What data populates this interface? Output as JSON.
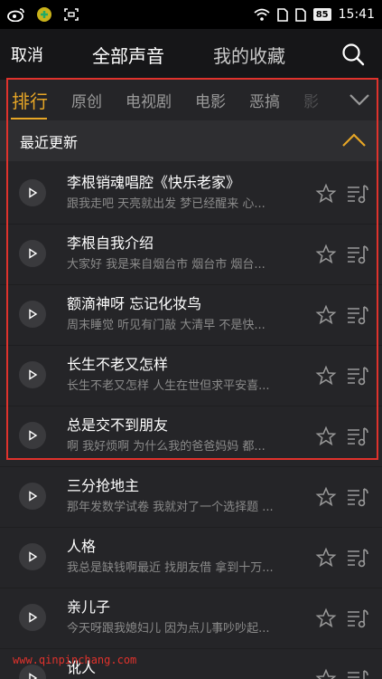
{
  "status_bar": {
    "time": "15:41",
    "battery": "85",
    "icons": [
      "weibo-icon",
      "app-icon",
      "scan-icon",
      "wifi-icon",
      "sim1-icon",
      "sim2-icon"
    ]
  },
  "header": {
    "cancel": "取消",
    "tabs": [
      "全部声音",
      "我的收藏"
    ],
    "active_tab": 0
  },
  "categories": {
    "items": [
      "排行",
      "原创",
      "电视剧",
      "电影",
      "恶搞",
      "影"
    ],
    "active": 0,
    "accent_color": "#e7a626"
  },
  "section": {
    "title": "最近更新"
  },
  "items": [
    {
      "title": "李根销魂唱腔《快乐老家》",
      "subtitle": "跟我走吧 天亮就出发 梦已经醒来 心..."
    },
    {
      "title": "李根自我介绍",
      "subtitle": "大家好 我是来自烟台市 烟台市 烟台..."
    },
    {
      "title": "额滴神呀 忘记化妆鸟",
      "subtitle": "周末睡觉 听见有门敲 大清早 不是快..."
    },
    {
      "title": "长生不老又怎样",
      "subtitle": "长生不老又怎样 人生在世但求平安喜..."
    },
    {
      "title": "总是交不到朋友",
      "subtitle": "啊 我好烦啊 为什么我的爸爸妈妈 都..."
    },
    {
      "title": "三分抢地主",
      "subtitle": "那年发数学试卷 我就对了一个选择题 ..."
    },
    {
      "title": "人格",
      "subtitle": "我总是缺钱啊最近 找朋友借 拿到十万..."
    },
    {
      "title": "亲儿子",
      "subtitle": "今天呀跟我媳妇儿 因为点儿事吵吵起..."
    },
    {
      "title": "讹人",
      "subtitle": ""
    }
  ],
  "watermark": "www.qinpinchang.com",
  "highlight_color": "#e0322c"
}
